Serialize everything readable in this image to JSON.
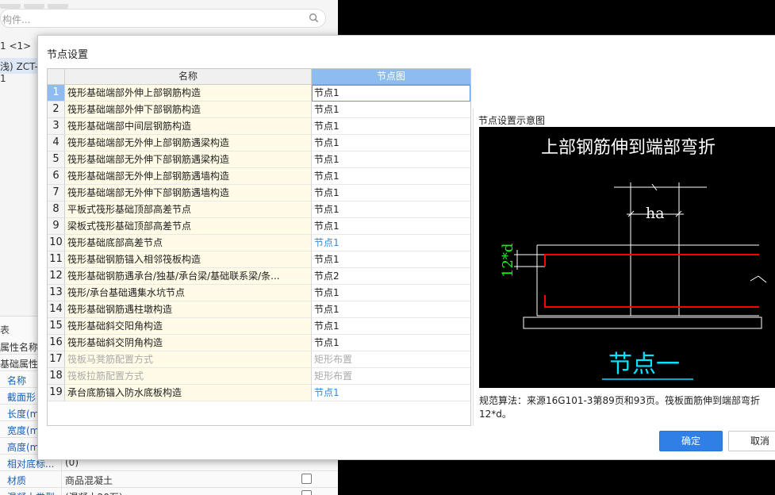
{
  "background": {
    "search_placeholder": "构件...",
    "tree_line1": "1 <1>",
    "tree_line2": "浅) ZCT-1",
    "props_header": "表",
    "props_rows": [
      {
        "key": "属性名称",
        "value": "",
        "plain": true
      },
      {
        "key": "基础属性",
        "value": "",
        "plain": true
      },
      {
        "key": "名称",
        "value": ""
      },
      {
        "key": "截面形",
        "value": ""
      },
      {
        "key": "长度(m",
        "value": ""
      },
      {
        "key": "宽度(m",
        "value": ""
      },
      {
        "key": "高度(m",
        "value": ""
      },
      {
        "key": "相对底标...",
        "value": "(0)"
      },
      {
        "key": "材质",
        "value": "商品混凝土",
        "checkbox": true
      },
      {
        "key": "混凝土类型",
        "value": "(混凝土20石)",
        "checkbox": true
      }
    ]
  },
  "dialog": {
    "title": "节点设置",
    "columns": {
      "name": "名称",
      "node": "节点图"
    },
    "rows": [
      {
        "num": "1",
        "name": "筏形基础端部外伸上部钢筋构造",
        "node": "节点1",
        "state": "selected"
      },
      {
        "num": "2",
        "name": "筏形基础端部外伸下部钢筋构造",
        "node": "节点1",
        "state": "normal"
      },
      {
        "num": "3",
        "name": "筏形基础端部中间层钢筋构造",
        "node": "节点1",
        "state": "normal"
      },
      {
        "num": "4",
        "name": "筏形基础端部无外伸上部钢筋遇梁构造",
        "node": "节点1",
        "state": "normal"
      },
      {
        "num": "5",
        "name": "筏形基础端部无外伸下部钢筋遇梁构造",
        "node": "节点1",
        "state": "normal"
      },
      {
        "num": "6",
        "name": "筏形基础端部无外伸上部钢筋遇墙构造",
        "node": "节点1",
        "state": "normal"
      },
      {
        "num": "7",
        "name": "筏形基础端部无外伸下部钢筋遇墙构造",
        "node": "节点1",
        "state": "normal"
      },
      {
        "num": "8",
        "name": "平板式筏形基础顶部高差节点",
        "node": "节点1",
        "state": "normal"
      },
      {
        "num": "9",
        "name": "梁板式筏形基础顶部高差节点",
        "node": "节点1",
        "state": "normal"
      },
      {
        "num": "10",
        "name": "筏形基础底部高差节点",
        "node": "节点1",
        "state": "blue"
      },
      {
        "num": "11",
        "name": "筏形基础钢筋锚入相邻筏板构造",
        "node": "节点1",
        "state": "normal"
      },
      {
        "num": "12",
        "name": "筏形基础钢筋遇承台/独基/承台梁/基础联系梁/条...",
        "node": "节点2",
        "state": "normal"
      },
      {
        "num": "13",
        "name": "筏形/承台基础遇集水坑节点",
        "node": "节点1",
        "state": "normal"
      },
      {
        "num": "14",
        "name": "筏形基础钢筋遇柱墩构造",
        "node": "节点1",
        "state": "normal"
      },
      {
        "num": "15",
        "name": "筏形基础斜交阳角构造",
        "node": "节点1",
        "state": "normal"
      },
      {
        "num": "16",
        "name": "筏形基础斜交阴角构造",
        "node": "节点1",
        "state": "normal"
      },
      {
        "num": "17",
        "name": "筏板马凳筋配置方式",
        "node": "矩形布置",
        "state": "disabled"
      },
      {
        "num": "18",
        "name": "筏板拉筋配置方式",
        "node": "矩形布置",
        "state": "disabled"
      },
      {
        "num": "19",
        "name": "承台底筋锚入防水底板构造",
        "node": "节点1",
        "state": "blue"
      }
    ],
    "preview_label": "节点设置示意图",
    "diagram": {
      "title": "上部钢筋伸到端部弯折",
      "dim_ha": "ha",
      "dim_12d": "12*d",
      "caption": "节点一"
    },
    "description": "规范算法：来源16G101-3第89页和93页。筏板面筋伸到端部弯折12*d。",
    "ok_label": "确定",
    "cancel_label": "取消"
  },
  "colors": {
    "accent": "#2f7fe6",
    "header_blue": "#8fbcf0",
    "row_name_bg": "#fffbe6",
    "rebar_red": "#ff0000",
    "dim_green": "#00ff00",
    "caption_cyan": "#00e5ff"
  }
}
